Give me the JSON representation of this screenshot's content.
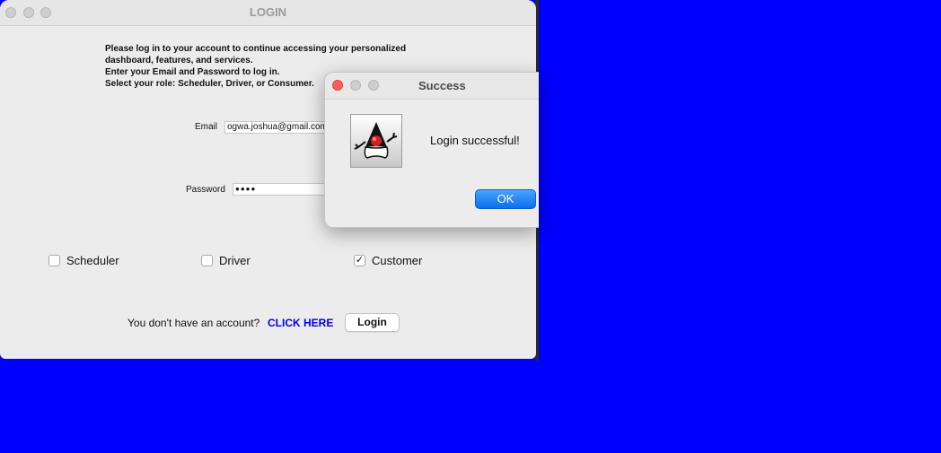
{
  "login_window": {
    "title": "LOGIN",
    "intro_lines": [
      "Please log in to your account to continue accessing your personalized",
      "dashboard, features, and services.",
      "Enter your Email and Password to log in.",
      "Select your role: Scheduler, Driver, or Consumer."
    ],
    "email": {
      "label": "Email",
      "value": "ogwa.joshua@gmail.com"
    },
    "password": {
      "label": "Password",
      "value": "●●●●"
    },
    "roles": [
      {
        "label": "Scheduler",
        "checked": false
      },
      {
        "label": "Driver",
        "checked": false
      },
      {
        "label": "Customer",
        "checked": true
      }
    ],
    "check_mark": "✓",
    "footer_text": "You don't have an account?",
    "signup_link": "CLICK HERE",
    "login_button": "Login"
  },
  "dialog": {
    "title": "Success",
    "message": "Login successful!",
    "ok_button": "OK",
    "icon": "java-duke-icon"
  },
  "colors": {
    "desktop": "#0000ff",
    "link": "#0000ee",
    "ok_button": "#0a6ff0",
    "close_red": "#ff5f57"
  }
}
